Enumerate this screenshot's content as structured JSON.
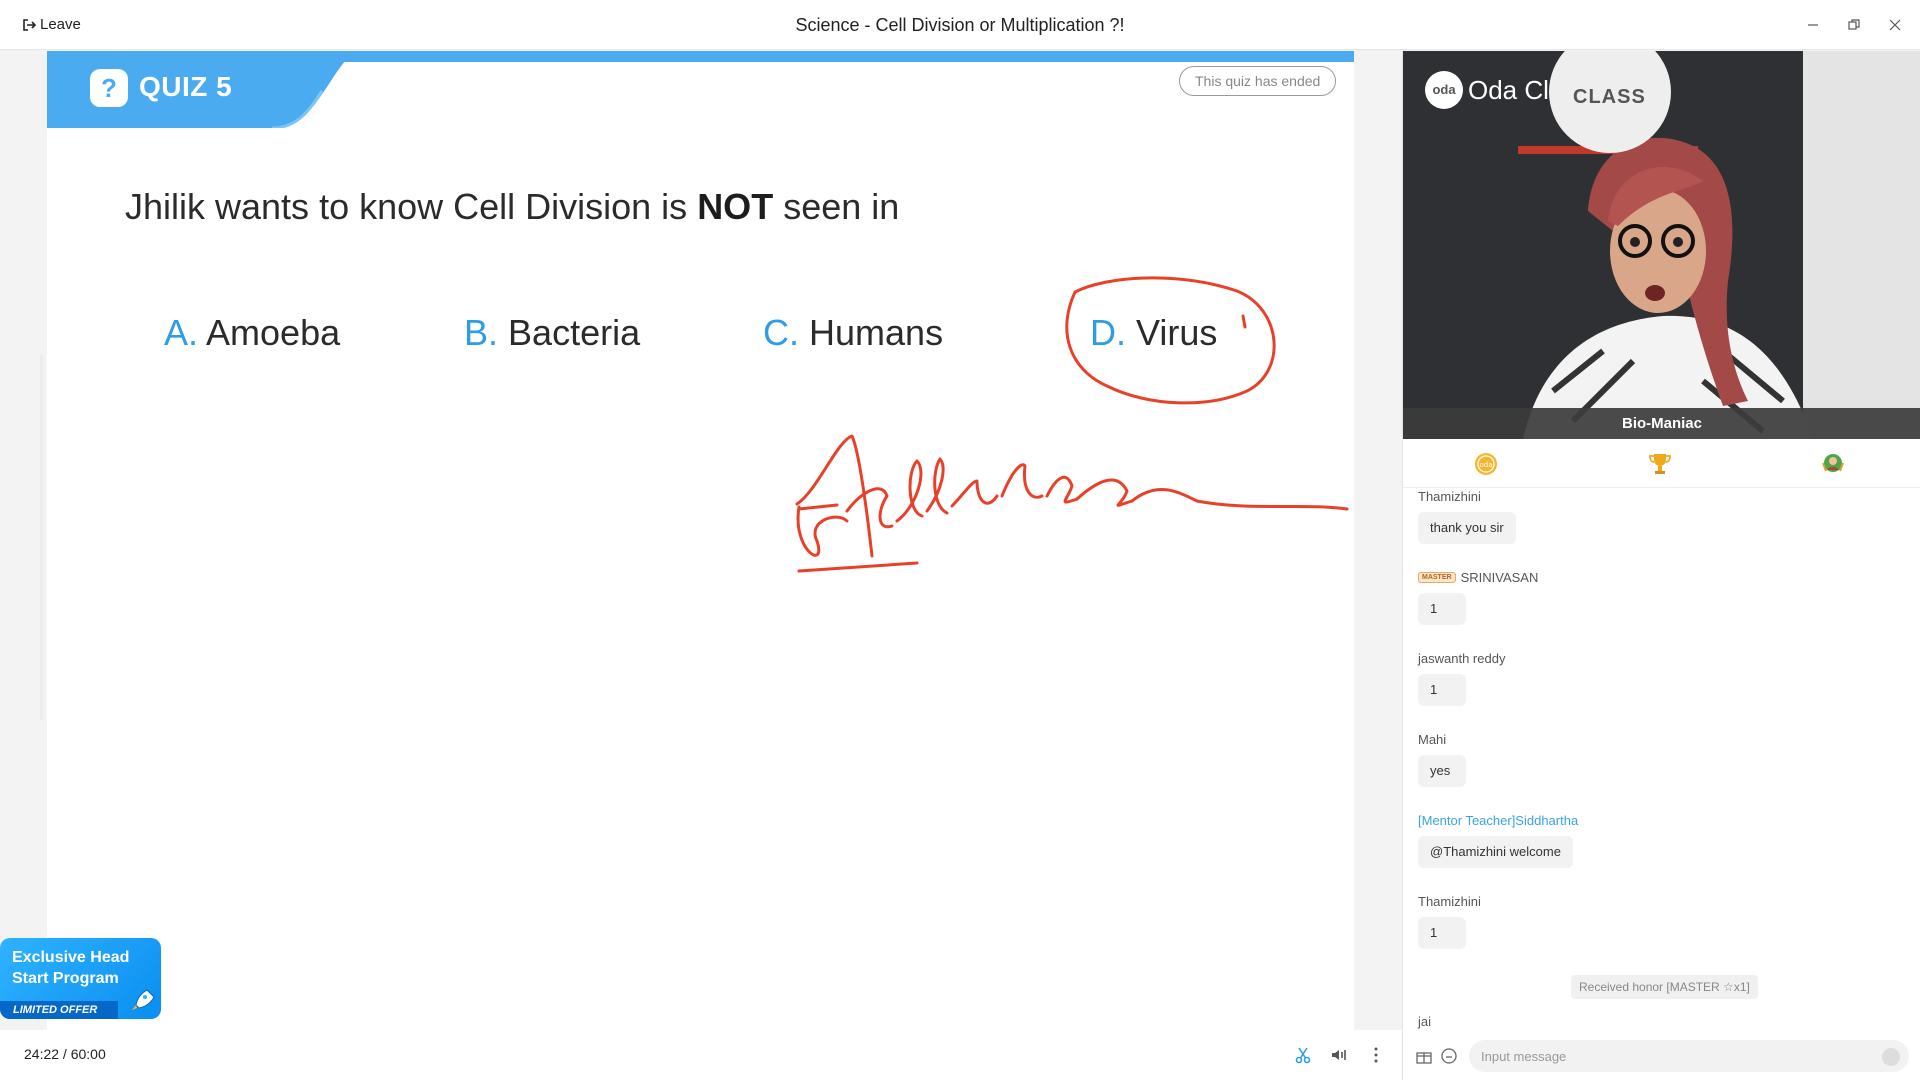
{
  "titlebar": {
    "leave_label": "Leave",
    "title": "Science - Cell Division or Multiplication ?!"
  },
  "quiz": {
    "label": "QUIZ 5",
    "q_icon": "?",
    "status": "This quiz has ended",
    "question_pre": "Jhilik wants to know Cell Division is ",
    "question_bold": "NOT",
    "question_post": " seen in",
    "options": [
      {
        "letter": "A.",
        "text": "Amoeba"
      },
      {
        "letter": "B.",
        "text": "Bacteria"
      },
      {
        "letter": "C.",
        "text": "Humans"
      },
      {
        "letter": "D.",
        "text": "Virus"
      }
    ],
    "annotation_color": "#e8412a"
  },
  "promo": {
    "title": "Exclusive Head Start Program",
    "offer": "LIMITED OFFER"
  },
  "bottombar": {
    "elapsed": "24:22",
    "separator": " / ",
    "total": "60:00"
  },
  "video": {
    "presenter_name": "Bio-Maniac",
    "logo_mark": "oda",
    "logo_text": "Oda Cl",
    "banner_text": "CLASS"
  },
  "chat": {
    "messages": [
      {
        "name": "Thamizhini",
        "text": "thank you sir",
        "badge": ""
      },
      {
        "name": "SRINIVASAN",
        "text": "1",
        "badge": "MASTER"
      },
      {
        "name": "jaswanth reddy",
        "text": "1",
        "badge": ""
      },
      {
        "name": "Mahi",
        "text": "yes",
        "badge": ""
      },
      {
        "name": "[Mentor Teacher]Siddhartha",
        "text": "@Thamizhini welcome",
        "badge": ""
      },
      {
        "name": "Thamizhini",
        "text": "1",
        "badge": ""
      }
    ],
    "honor_notice": "Received honor [MASTER ☆x1]",
    "last_name": "jai",
    "input_placeholder": "Input message"
  },
  "colors": {
    "accent": "#4aabf0",
    "option_letter": "#2e9de7",
    "mentor_name": "#3aa2e8"
  }
}
